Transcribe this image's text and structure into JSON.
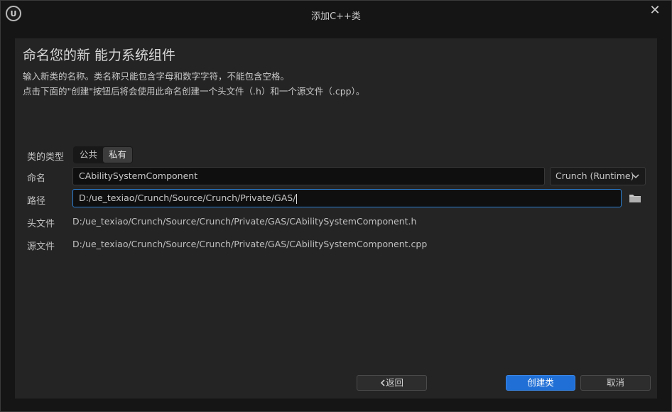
{
  "window": {
    "title": "添加C++类",
    "logo_text": "U",
    "close_symbol": "✕"
  },
  "header": {
    "title": "命名您的新 能力系统组件",
    "line1": "输入新类的名称。类名称只能包含字母和数字字符，不能包含空格。",
    "line2": "点击下面的\"创建\"按钮后将会使用此命名创建一个头文件（.h）和一个源文件（.cpp）。"
  },
  "form": {
    "class_type_label": "类的类型",
    "class_type_options": [
      "公共",
      "私有"
    ],
    "class_type_selected": "私有",
    "name_label": "命名",
    "name_value": "CAbilitySystemComponent",
    "module_value": "Crunch (Runtime)",
    "path_label": "路径",
    "path_value": "D:/ue_texiao/Crunch/Source/Crunch/Private/GAS/",
    "header_label": "头文件",
    "header_value": "D:/ue_texiao/Crunch/Source/Crunch/Private/GAS/CAbilitySystemComponent.h",
    "source_label": "源文件",
    "source_value": "D:/ue_texiao/Crunch/Source/Crunch/Private/GAS/CAbilitySystemComponent.cpp"
  },
  "buttons": {
    "back": "返回",
    "back_icon": "chevron-left-icon",
    "create": "创建类",
    "cancel": "取消"
  },
  "colors": {
    "accent": "#1f6fd6",
    "focus_border": "#2b7fd3",
    "panel": "#242424",
    "background": "#151515"
  }
}
